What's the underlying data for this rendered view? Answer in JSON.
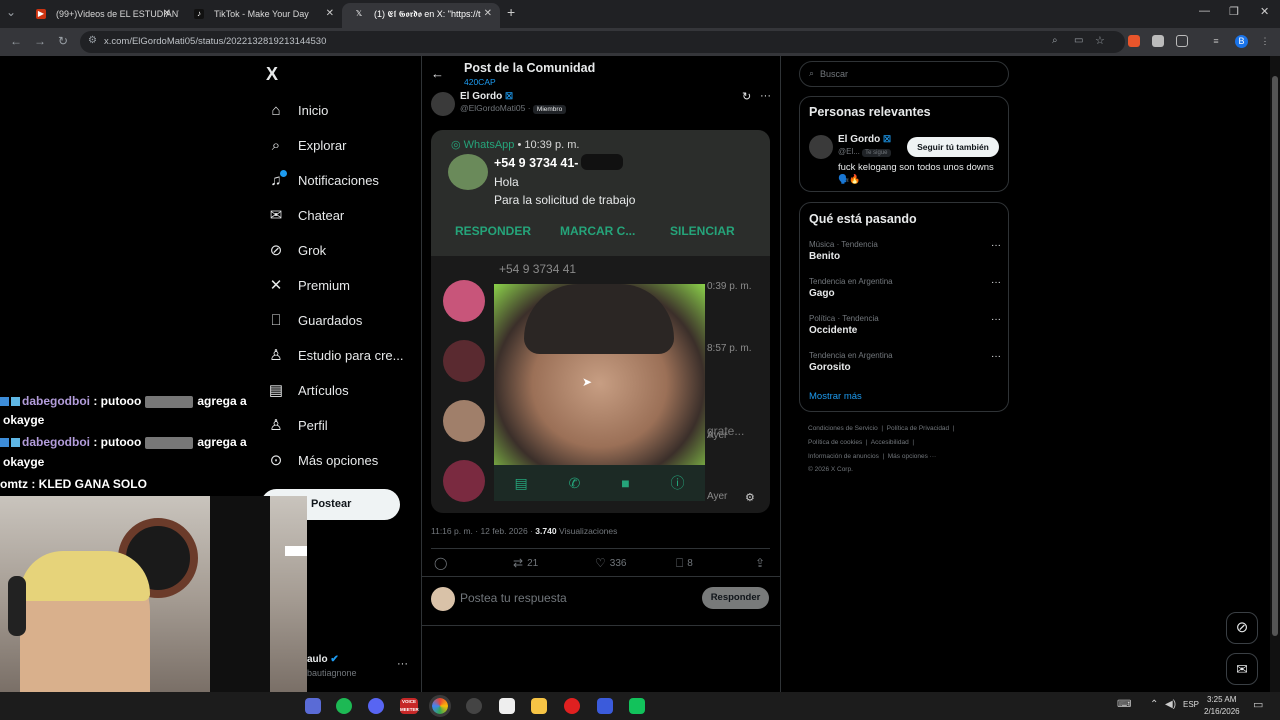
{
  "browser": {
    "tabs": [
      {
        "title": "(99+)Videos de EL ESTUDIANTE",
        "active": false
      },
      {
        "title": "TikTok - Make Your Day",
        "active": false
      },
      {
        "title": "(1) 𝕰𝖑 𝕲𝖔𝖗𝖉𝖔 en X: \"https://t",
        "active": true
      }
    ],
    "url": "x.com/ElGordoMati05/status/2022132819213144530",
    "profile_initial": "B"
  },
  "nav": {
    "logo": "X",
    "items": [
      {
        "label": "Inicio",
        "icon": "home-icon"
      },
      {
        "label": "Explorar",
        "icon": "search-icon"
      },
      {
        "label": "Notificaciones",
        "icon": "bell-icon"
      },
      {
        "label": "Chatear",
        "icon": "mail-icon"
      },
      {
        "label": "Grok",
        "icon": "grok-icon"
      },
      {
        "label": "Premium",
        "icon": "x-icon"
      },
      {
        "label": "Guardados",
        "icon": "bookmark-icon"
      },
      {
        "label": "Estudio para cre...",
        "icon": "studio-icon"
      },
      {
        "label": "Artículos",
        "icon": "article-icon"
      },
      {
        "label": "Perfil",
        "icon": "person-icon"
      },
      {
        "label": "Más opciones",
        "icon": "more-icon"
      }
    ],
    "post_button": "Postear",
    "account_name": "aulo",
    "account_handle": "bautiagnone",
    "account_more": "···"
  },
  "chat": [
    {
      "user": "dabegodboi",
      "text": ": putooo",
      "after": "agrega a",
      "cont": "okayge"
    },
    {
      "user": "dabegodboi",
      "text": ": putooo",
      "after": "agrega a",
      "cont": "okayge"
    },
    {
      "user": "omtz",
      "text": ": KLED GANA SOLO"
    }
  ],
  "post": {
    "header_title": "Post de la Comunidad",
    "community": "420CAP",
    "author_name": "El Gordo",
    "author_handle": "@ElGordoMati05",
    "author_sep": "·",
    "author_badge": "Miembro",
    "timestamp": "11:16 p. m. · 12 feb. 2026 ·",
    "views_count": "3.740",
    "views_label": "Visualizaciones",
    "stats": {
      "replies": "",
      "reposts": "21",
      "likes": "336",
      "bookmarks": "8"
    },
    "reply_placeholder": "Postea tu respuesta",
    "reply_button": "Responder"
  },
  "media": {
    "app": "WhatsApp",
    "time": "• 10:39 p. m.",
    "number": "+54 9 3734 41-",
    "msg1": "Hola",
    "msg2": "Para la solicitud de trabajo",
    "actions": [
      "RESPONDER",
      "MARCAR C...",
      "SILENCIAR"
    ],
    "bg_number": "+54 9 3734 41",
    "bg_times": [
      "0:39 p. m.",
      "8:57 p. m.",
      "Ayer",
      "Ayer"
    ],
    "bg_snippet": "grate..."
  },
  "right": {
    "search_placeholder": "Buscar",
    "relevant_title": "Personas relevantes",
    "person_name": "El Gordo",
    "person_handle": "@El...",
    "person_follows": "Te sigue",
    "follow_button": "Seguir tú también",
    "person_bio": "fuck kelogang son todos unos downs",
    "person_bio_emoji": "🗣️🔥",
    "trends_title": "Qué está pasando",
    "trends": [
      {
        "meta": "Música · Tendencia",
        "name": "Benito"
      },
      {
        "meta": "Tendencia en Argentina",
        "name": "Gago"
      },
      {
        "meta": "Política · Tendencia",
        "name": "Occidente"
      },
      {
        "meta": "Tendencia en Argentina",
        "name": "Gorosito"
      }
    ],
    "show_more": "Mostrar más",
    "footer": {
      "line1": [
        "Condiciones de Servicio",
        "Política de Privacidad"
      ],
      "line2": [
        "Política de cookies",
        "Accesibilidad"
      ],
      "line3": [
        "Información de anuncios",
        "Más opciones ···"
      ],
      "copyright": "© 2026 X Corp."
    }
  },
  "taskbar": {
    "lang": "ESP",
    "time": "3:25 AM",
    "date": "2/16/2026",
    "video_label": "VOICE MEETER"
  },
  "colors": {
    "accent": "#1d9bf0",
    "whatsapp": "#25a47a"
  }
}
